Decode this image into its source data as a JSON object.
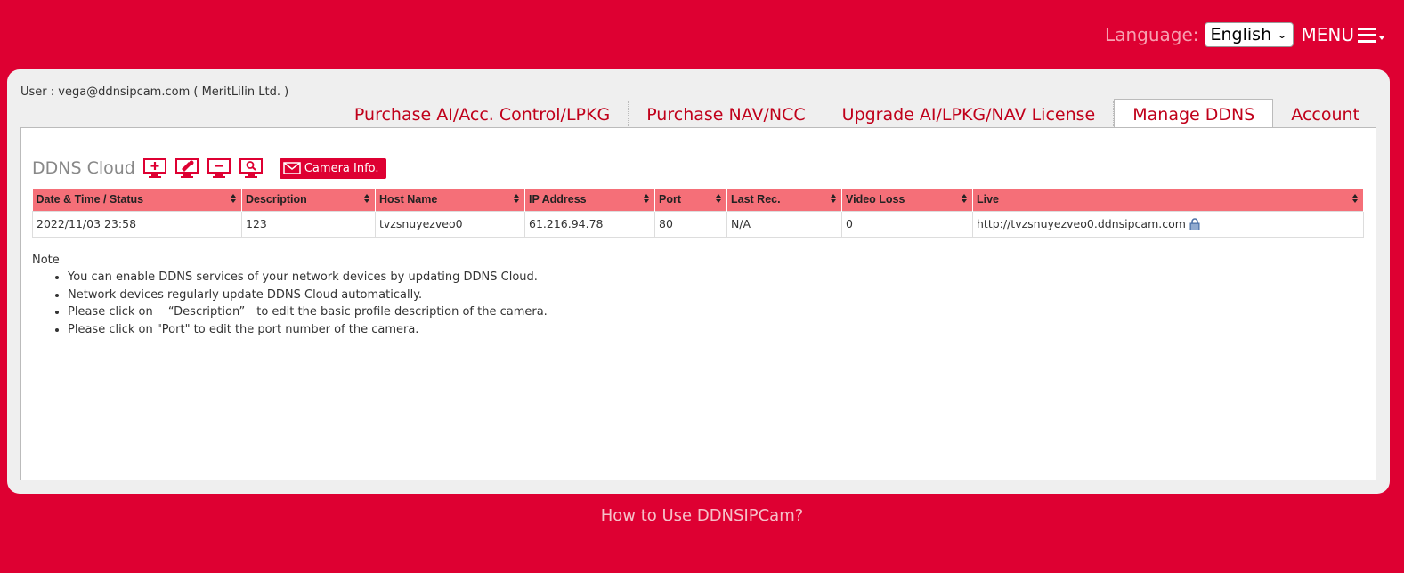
{
  "header": {
    "language_label": "Language:",
    "language_selected": "English",
    "menu_label": "MENU"
  },
  "user_line": "User : vega@ddnsipcam.com ( MeritLilin Ltd. )",
  "tabs": [
    {
      "label": "Purchase AI/Acc. Control/LPKG",
      "active": false
    },
    {
      "label": "Purchase NAV/NCC",
      "active": false
    },
    {
      "label": "Upgrade AI/LPKG/NAV License",
      "active": false
    },
    {
      "label": "Manage DDNS",
      "active": true
    },
    {
      "label": "Account",
      "active": false
    }
  ],
  "section": {
    "title": "DDNS Cloud",
    "icons": [
      "add-device-icon",
      "edit-device-icon",
      "remove-device-icon",
      "search-device-icon"
    ],
    "camera_info_label": "Camera Info."
  },
  "table": {
    "columns": [
      "Date & Time / Status",
      "Description",
      "Host Name",
      "IP Address",
      "Port",
      "Last Rec.",
      "Video Loss",
      "Live"
    ],
    "rows": [
      {
        "datetime": "2022/11/03 23:58",
        "description": "123",
        "host": "tvzsnuyezveo0",
        "ip": "61.216.94.78",
        "port": "80",
        "last_rec": "N/A",
        "video_loss": "0",
        "live": "http://tvzsnuyezveo0.ddnsipcam.com"
      }
    ]
  },
  "note": {
    "title": "Note",
    "items": [
      "You can enable DDNS services of your network devices by updating DDNS Cloud.",
      "Network devices regularly update DDNS Cloud automatically.",
      "Please click on 　“Description”　to edit the basic profile description of the camera.",
      "Please click on \"Port\" to edit the port number of the camera."
    ]
  },
  "footer_link": "How to Use DDNSIPCam?",
  "colors": {
    "brand_red": "#de0032",
    "header_row": "#f56f78",
    "link": "#c0001a"
  }
}
